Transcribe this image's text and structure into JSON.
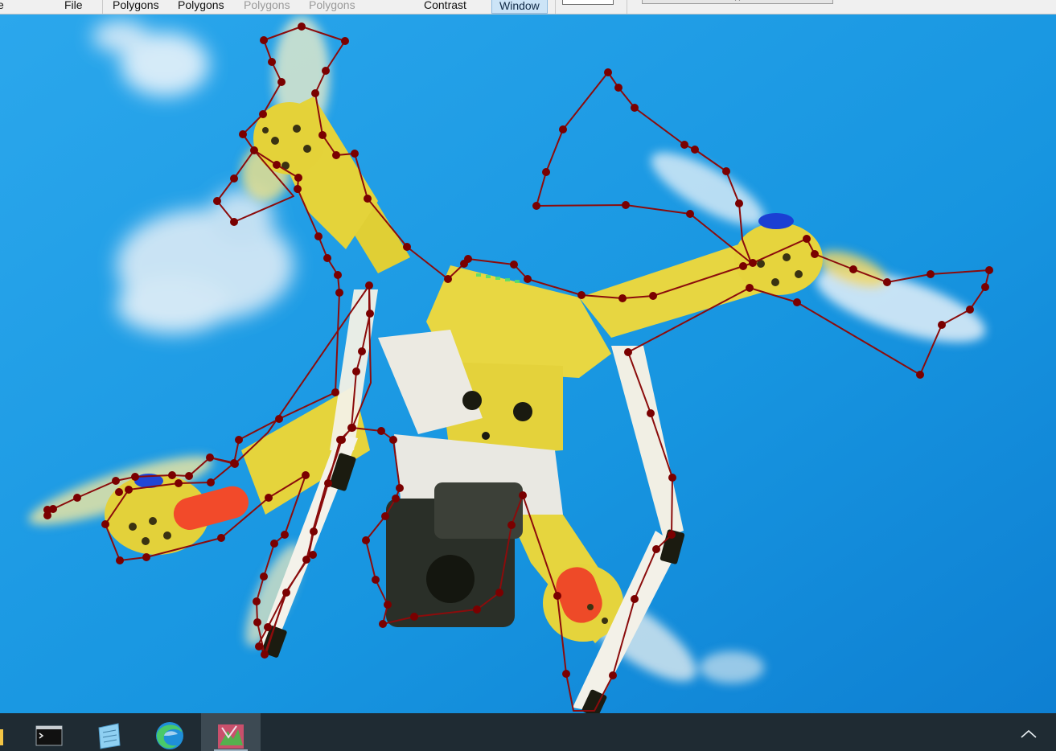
{
  "menu": {
    "file": "File",
    "polygons_1": "Polygons",
    "polygons_2": "Polygons",
    "polygons_3": "Polygons",
    "polygons_4": "Polygons",
    "contrast": "Contrast",
    "window": "Window",
    "status_text": "(       )"
  },
  "image": {
    "subject": "drone",
    "sky_color": "#1b9be2",
    "drone_color": "#e3d23b"
  },
  "annotation": {
    "stroke_color": "#8b0c0c",
    "vertex_color": "#7a0000"
  },
  "taskbar": {
    "apps": [
      {
        "icon": "folder-icon"
      },
      {
        "icon": "terminal-icon"
      },
      {
        "icon": "notepad-icon"
      },
      {
        "icon": "edge-browser-icon"
      },
      {
        "icon": "annotation-app-icon",
        "active": true
      }
    ],
    "tray": {
      "icon": "chevron-up-icon"
    }
  }
}
